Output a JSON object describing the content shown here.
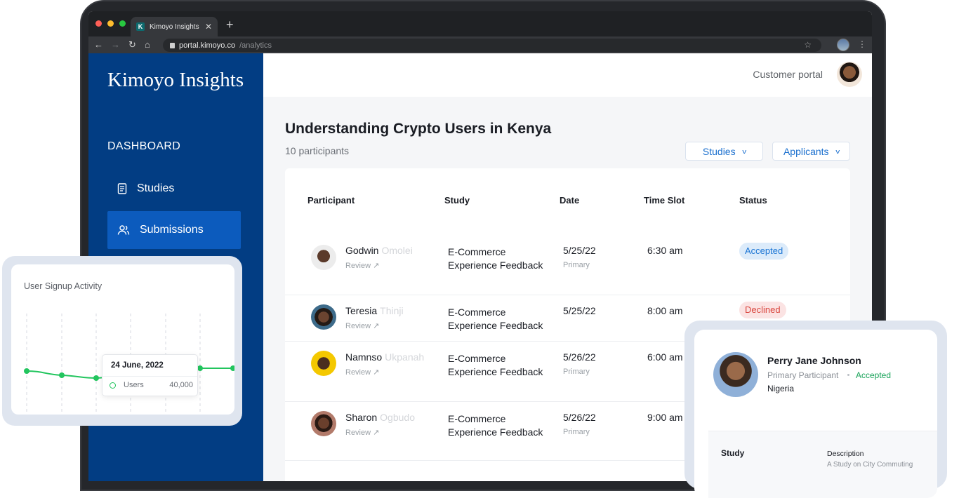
{
  "browser": {
    "tab_favicon": "K",
    "tab_title": "Kimoyo Insights",
    "tab_close": "✕",
    "new_tab": "+",
    "url_host": "portal.kimoyo.co",
    "url_path": "/analytics"
  },
  "colors": {
    "sidebar": "#023d83",
    "sidebar_active": "#0c5bbd",
    "accent": "#1a6fce",
    "accepted_bg": "#dcebfa",
    "declined_bg": "#fbe3e3",
    "chart_line": "#22c55e"
  },
  "sidebar": {
    "brand": "Kimoyo Insights",
    "section": "DASHBOARD",
    "items": [
      {
        "label": "Studies",
        "icon": "document-icon",
        "active": false
      },
      {
        "label": "Submissions",
        "icon": "users-icon",
        "active": true
      }
    ]
  },
  "header": {
    "portal_label": "Customer portal"
  },
  "main": {
    "title": "Understanding Crypto Users in Kenya",
    "subtitle": "10 participants",
    "filters": [
      "Studies",
      "Applicants"
    ],
    "columns": [
      "Participant",
      "Study",
      "Date",
      "Time Slot",
      "Status"
    ],
    "rows": [
      {
        "first": "Godwin",
        "last": "Omolei",
        "review": "Review",
        "study_line1": "E-Commerce",
        "study_line2": "Experience Feedback",
        "date": "5/25/22",
        "slot_type": "Primary",
        "time": "6:30 am",
        "status": "Accepted"
      },
      {
        "first": "Teresia",
        "last": "Thinji",
        "review": "Review",
        "study_line1": "E-Commerce",
        "study_line2": "Experience Feedback",
        "date": "5/25/22",
        "slot_type": "",
        "time": "8:00 am",
        "status": "Declined"
      },
      {
        "first": "Namnso",
        "last": "Ukpanah",
        "review": "Review",
        "study_line1": "E-Commerce",
        "study_line2": "Experience Feedback",
        "date": "5/26/22",
        "slot_type": "Primary",
        "time": "6:00 am",
        "status": ""
      },
      {
        "first": "Sharon",
        "last": "Ogbudo",
        "review": "Review",
        "study_line1": "E-Commerce",
        "study_line2": "Experience Feedback",
        "date": "5/26/22",
        "slot_type": "Primary",
        "time": "9:00 am",
        "status": ""
      }
    ]
  },
  "signup_card": {
    "title": "User Signup Activity",
    "tooltip_date": "24 June, 2022",
    "tooltip_series": "Users",
    "tooltip_value": "40,000"
  },
  "profile_card": {
    "name": "Perry Jane Johnson",
    "role": "Primary Participant",
    "status": "Accepted",
    "country": "Nigeria",
    "study_heading": "Study",
    "description_heading": "Description",
    "description": "A Study on City Commuting"
  }
}
